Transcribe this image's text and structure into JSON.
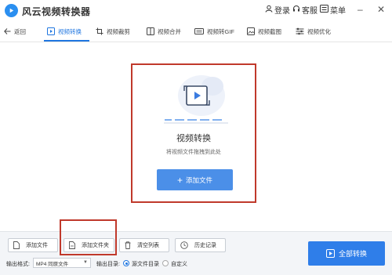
{
  "app": {
    "title": "风云视频转换器"
  },
  "titlebar": {
    "login": "登录",
    "support": "客服",
    "menu": "菜单"
  },
  "nav": {
    "back": "返回",
    "tabs": [
      {
        "label": "视频转换",
        "active": true
      },
      {
        "label": "视频裁剪"
      },
      {
        "label": "视频合并"
      },
      {
        "label": "视频转GIF"
      },
      {
        "label": "视频截图"
      },
      {
        "label": "视频优化"
      }
    ]
  },
  "main": {
    "title": "视频转换",
    "hint": "将视频文件拖拽到此处",
    "add_file_button": "添加文件"
  },
  "toolbar": {
    "add_file": "添加文件",
    "add_folder": "添加文件夹",
    "clear_list": "清空列表",
    "history": "历史记录",
    "output_format_label": "输出格式:",
    "output_format_value": "MP4 同原文件",
    "output_dir_label": "输出目录:",
    "dir_option_source": "源文件目录",
    "dir_option_custom": "自定义",
    "convert_all": "全部转换"
  },
  "colors": {
    "accent": "#2f7ee9",
    "highlight": "#c0392b"
  }
}
